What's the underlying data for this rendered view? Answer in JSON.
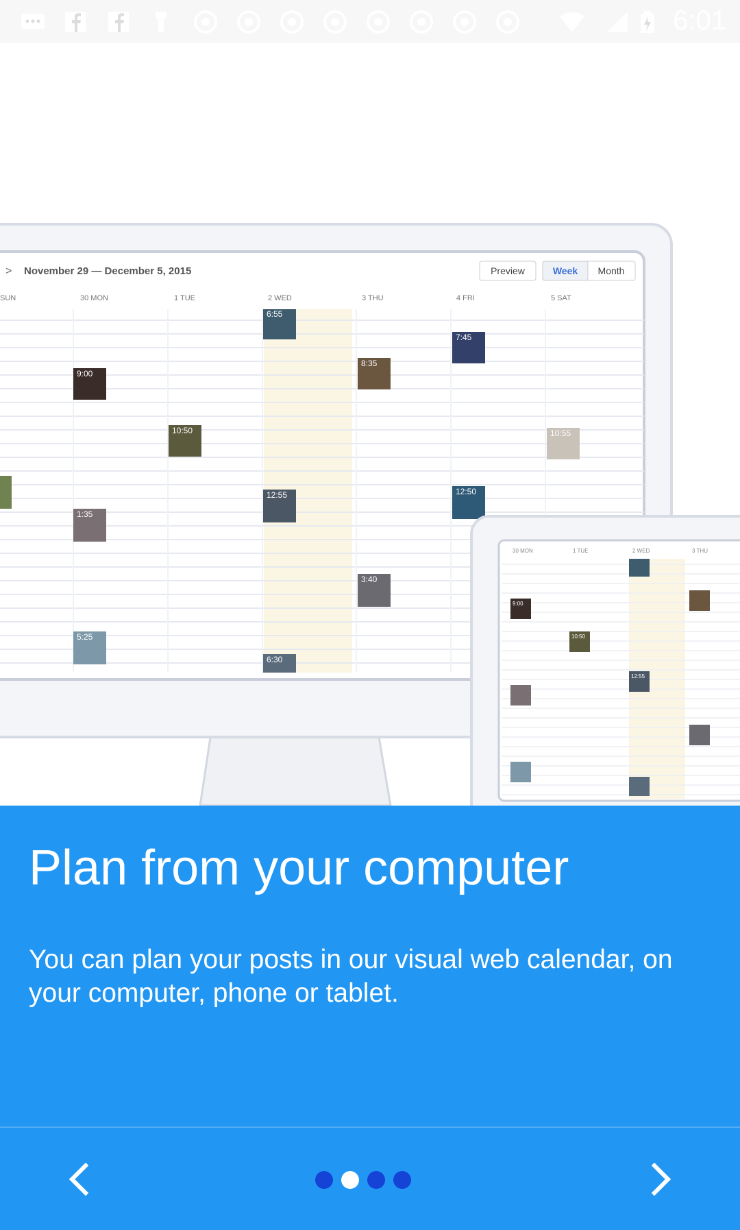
{
  "status_bar": {
    "time": "6:01",
    "icons": [
      "message-icon",
      "facebook-icon",
      "facebook-icon",
      "flashlight-icon",
      "sync-icon",
      "sync-icon",
      "sync-icon",
      "sync-icon",
      "sync-icon",
      "sync-icon",
      "sync-icon",
      "sync-icon",
      "wifi-icon",
      "signal-icon",
      "battery-icon"
    ]
  },
  "illustration": {
    "monitor": {
      "date_range": "November 29 — December 5, 2015",
      "buttons": [
        "Preview",
        "Week",
        "Month"
      ],
      "days": [
        "SUN",
        "30 MON",
        "1 TUE",
        "2 WED",
        "3 THU",
        "4 FRI",
        "5 SAT"
      ],
      "thumbs": [
        "6:55",
        "7:45",
        "8:35",
        "9:00",
        "10:50",
        "10:55",
        "12:55",
        "12:50",
        "1:35",
        "3:40",
        "5:25",
        "6:30"
      ]
    },
    "tablet": {
      "days": [
        "30 MON",
        "1 TUE",
        "2 WED",
        "3 THU"
      ],
      "thumbs": [
        "9:00",
        "10:50",
        "12:55"
      ]
    }
  },
  "onboarding": {
    "title": "Plan from your computer",
    "description": "You can plan your posts in our visual web calendar, on your computer, phone or tablet.",
    "page_index": 2,
    "page_count": 4
  },
  "colors": {
    "panel": "#2196F3",
    "dot_active": "#ffffff",
    "dot_inactive": "#1443d6",
    "highlight_column": "#fbf6e4"
  }
}
